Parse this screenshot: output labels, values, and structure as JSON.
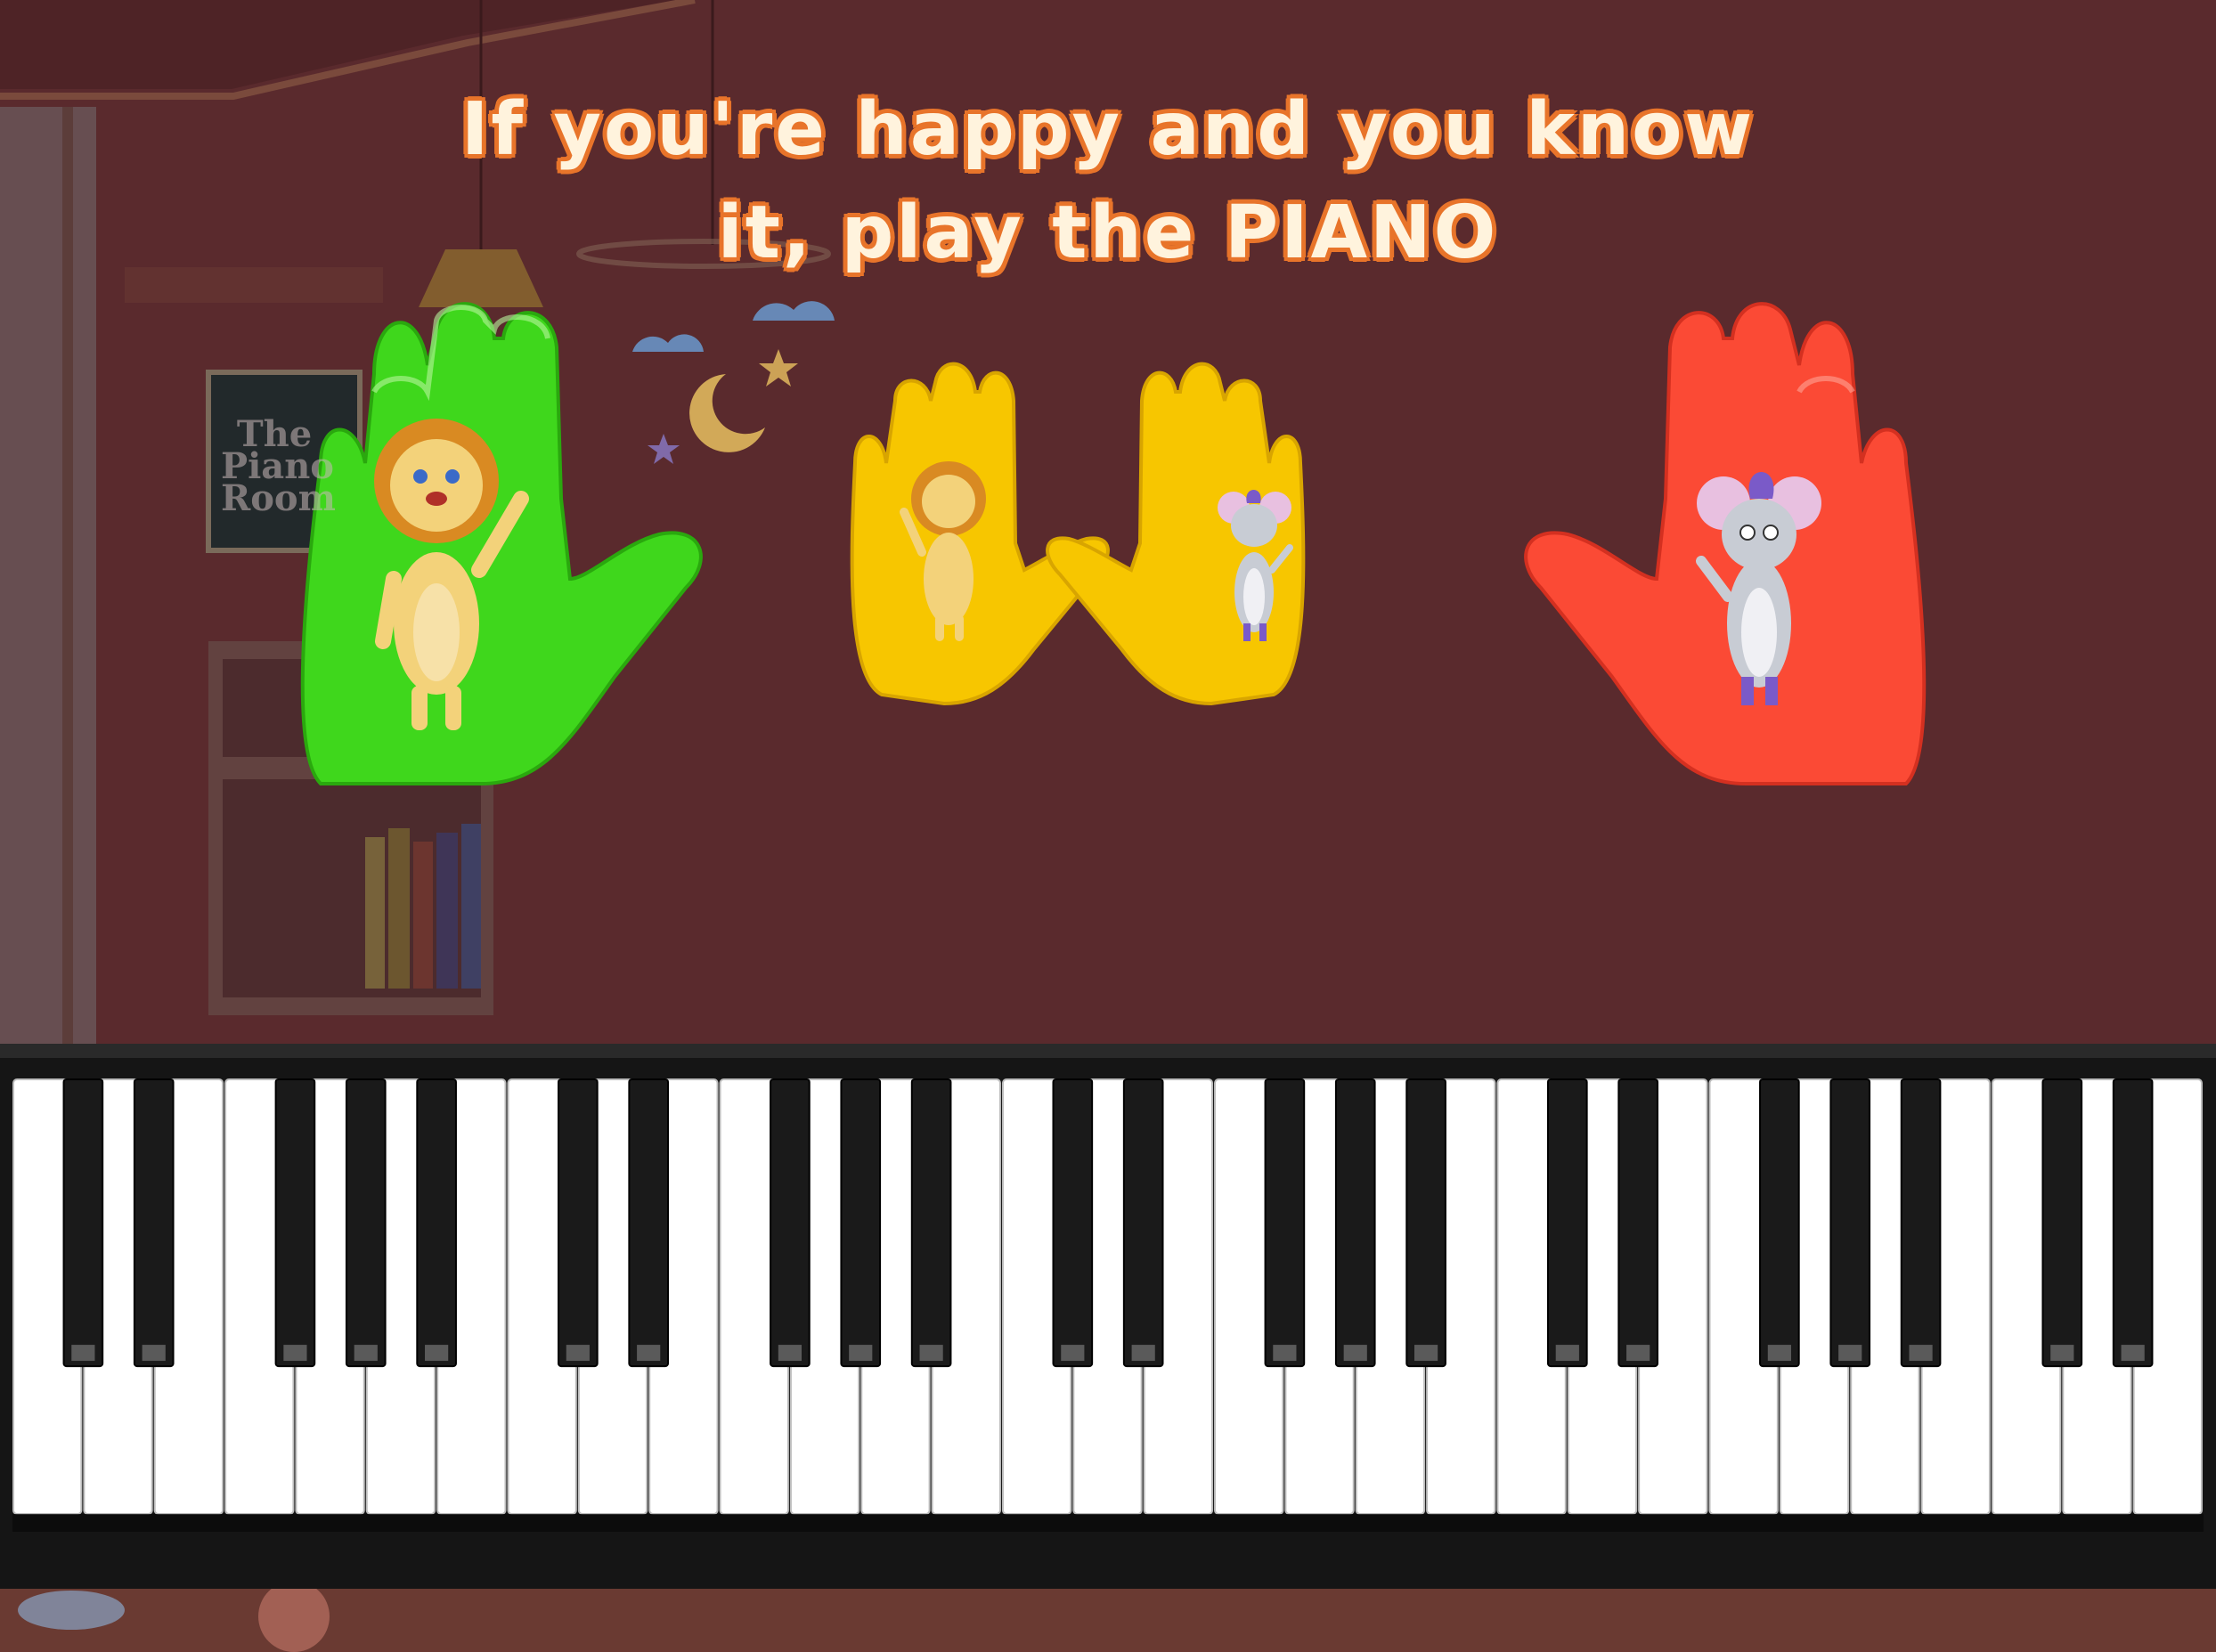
{
  "lyric": {
    "line1": "If you're happy and you know",
    "line2": "it, play the PIANO"
  },
  "poster": {
    "text": "The Piano Room"
  },
  "hands": [
    {
      "id": "left-big",
      "color": "#3fd71c",
      "character": "lion"
    },
    {
      "id": "left-small",
      "color": "#f7c600",
      "character": "lion"
    },
    {
      "id": "right-small",
      "color": "#f7c600",
      "character": "mouse"
    },
    {
      "id": "right-big",
      "color": "#fb4a35",
      "character": "mouse"
    }
  ],
  "piano": {
    "white_key_count": 31,
    "black_key_pattern": [
      1,
      1,
      0,
      1,
      1,
      1,
      0
    ],
    "frame_color": "#151515",
    "white_key_color": "#ffffff",
    "black_key_color": "#1a1a1a"
  },
  "colors": {
    "wall": "#5e2c2f",
    "text_fill": "#fff3dd",
    "text_outline": "#e8742a"
  }
}
